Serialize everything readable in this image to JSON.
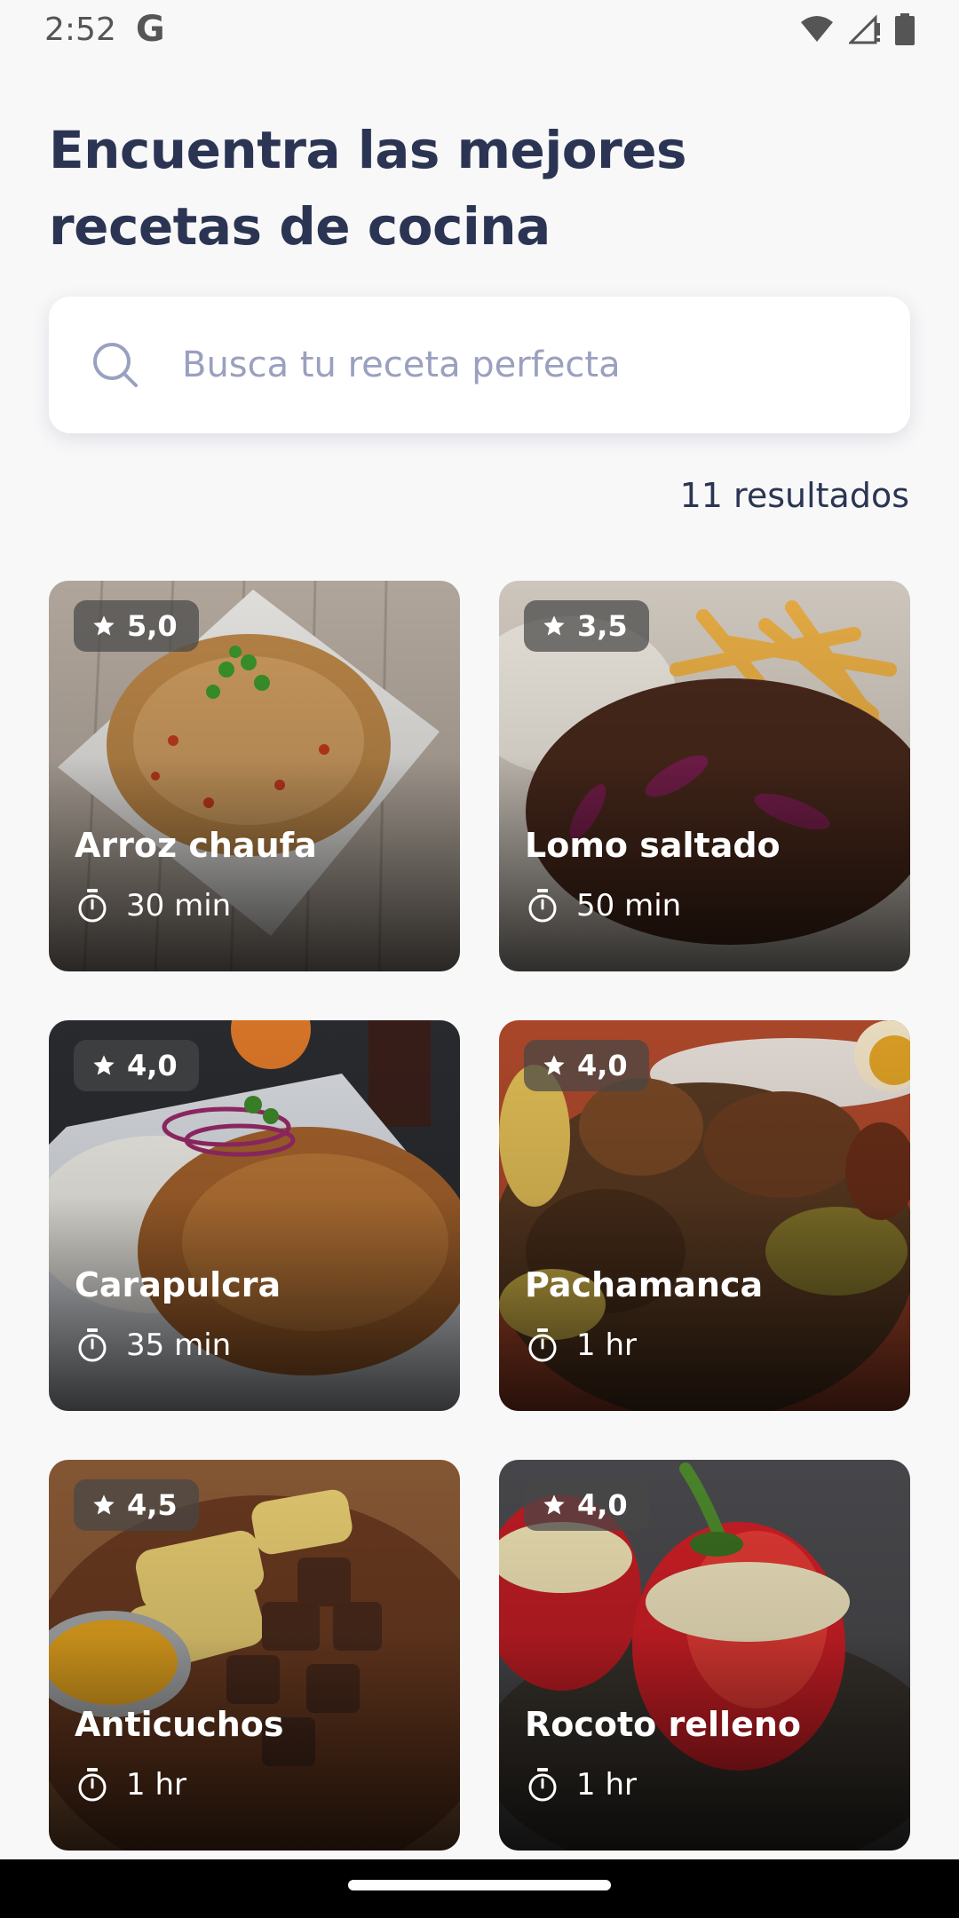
{
  "status_bar": {
    "time": "2:52",
    "g_icon": "G"
  },
  "title_line1": "Encuentra las mejores",
  "title_line2": "recetas de cocina",
  "search": {
    "placeholder": "Busca tu receta perfecta"
  },
  "results_count": "11 resultados",
  "recipes": [
    {
      "name": "Arroz chaufa",
      "rating": "5,0",
      "time": "30 min"
    },
    {
      "name": "Lomo saltado",
      "rating": "3,5",
      "time": "50 min"
    },
    {
      "name": "Carapulcra",
      "rating": "4,0",
      "time": "35 min"
    },
    {
      "name": "Pachamanca",
      "rating": "4,0",
      "time": "1 hr"
    },
    {
      "name": "Anticuchos",
      "rating": "4,5",
      "time": "1 hr"
    },
    {
      "name": "Rocoto relleno",
      "rating": "4,0",
      "time": "1 hr"
    }
  ],
  "colors": {
    "title": "#2b3553",
    "placeholder": "#9aa0bf",
    "background": "#f8f8f9"
  }
}
